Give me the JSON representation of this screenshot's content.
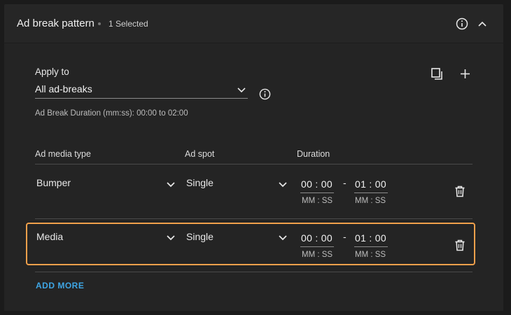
{
  "header": {
    "title": "Ad break pattern",
    "selected": "1 Selected",
    "icons": {
      "info": "info-icon",
      "collapse": "chevron-up-icon"
    }
  },
  "apply_to": {
    "label": "Apply to",
    "value": "All ad-breaks",
    "duration_hint": "Ad Break Duration (mm:ss): 00:00 to 02:00"
  },
  "table": {
    "headers": {
      "media_type": "Ad media type",
      "spot": "Ad spot",
      "duration": "Duration"
    },
    "rows": [
      {
        "media_type": "Bumper",
        "spot": "Single",
        "start": "00 : 00",
        "end": "01 : 00",
        "start_unit": "MM : SS",
        "end_unit": "MM : SS",
        "dash": "-",
        "selected": false
      },
      {
        "media_type": "Media",
        "spot": "Single",
        "start": "00 : 00",
        "end": "01 : 00",
        "start_unit": "MM : SS",
        "end_unit": "MM : SS",
        "dash": "-",
        "selected": true
      }
    ]
  },
  "add_more": "ADD MORE",
  "colors": {
    "accent": "#3ea6e5",
    "selection": "#f0a04b",
    "panel": "#262626"
  }
}
